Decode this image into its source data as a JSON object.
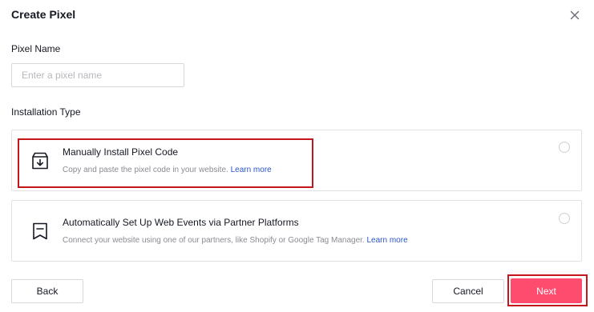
{
  "dialog": {
    "title": "Create Pixel",
    "close_icon": "close-icon"
  },
  "pixel_name": {
    "label": "Pixel Name",
    "value": "",
    "placeholder": "Enter a pixel name"
  },
  "installation_type": {
    "label": "Installation Type",
    "options": [
      {
        "title": "Manually Install Pixel Code",
        "description": "Copy and paste the pixel code in your website.",
        "link": "Learn more",
        "icon": "download-box-icon",
        "selected": false
      },
      {
        "title": "Automatically Set Up Web Events via Partner Platforms",
        "description": "Connect your website using one of our partners, like Shopify or Google Tag Manager.",
        "link": "Learn more",
        "icon": "bookmark-flag-icon",
        "selected": false
      }
    ]
  },
  "footer": {
    "back_label": "Back",
    "cancel_label": "Cancel",
    "next_label": "Next"
  },
  "colors": {
    "primary": "#fe4c6e",
    "link": "#2a55c6",
    "highlight": "#c4171b"
  }
}
